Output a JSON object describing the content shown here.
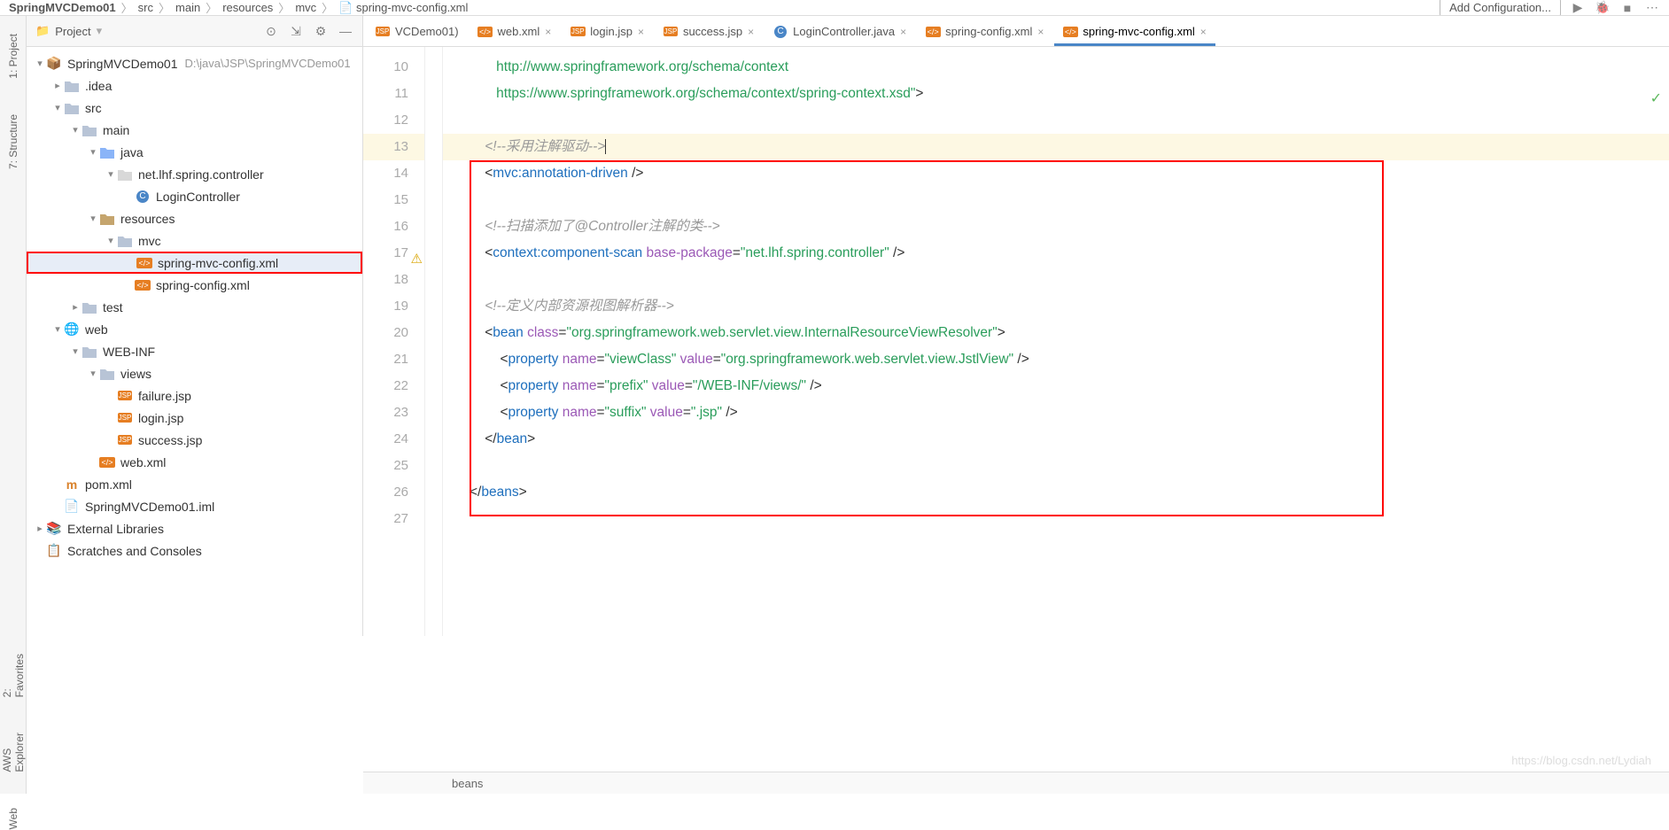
{
  "breadcrumb": [
    "SpringMVCDemo01",
    "src",
    "main",
    "resources",
    "mvc",
    "spring-mvc-config.xml"
  ],
  "addConfig": "Add Configuration...",
  "leftRail": [
    "1: Project",
    "7: Structure",
    "2: Favorites",
    "AWS Explorer",
    "Web"
  ],
  "panel": {
    "title": "Project",
    "root": "SpringMVCDemo01",
    "rootPath": "D:\\java\\JSP\\SpringMVCDemo01"
  },
  "tree": [
    {
      "ind": 0,
      "chev": "down",
      "type": "module",
      "label": "SpringMVCDemo01",
      "extra": "rootPath"
    },
    {
      "ind": 1,
      "chev": "right",
      "type": "folder",
      "label": ".idea"
    },
    {
      "ind": 1,
      "chev": "down",
      "type": "folder",
      "label": "src"
    },
    {
      "ind": 2,
      "chev": "down",
      "type": "folder",
      "label": "main"
    },
    {
      "ind": 3,
      "chev": "down",
      "type": "src",
      "label": "java"
    },
    {
      "ind": 4,
      "chev": "down",
      "type": "pkg",
      "label": "net.lhf.spring.controller"
    },
    {
      "ind": 5,
      "chev": "",
      "type": "class",
      "label": "LoginController"
    },
    {
      "ind": 3,
      "chev": "down",
      "type": "res",
      "label": "resources"
    },
    {
      "ind": 4,
      "chev": "down",
      "type": "folder",
      "label": "mvc"
    },
    {
      "ind": 5,
      "chev": "",
      "type": "xml",
      "label": "spring-mvc-config.xml",
      "active": true,
      "redbox": true
    },
    {
      "ind": 5,
      "chev": "",
      "type": "xml",
      "label": "spring-config.xml"
    },
    {
      "ind": 2,
      "chev": "right",
      "type": "folder",
      "label": "test"
    },
    {
      "ind": 1,
      "chev": "down",
      "type": "web",
      "label": "web"
    },
    {
      "ind": 2,
      "chev": "down",
      "type": "folder",
      "label": "WEB-INF"
    },
    {
      "ind": 3,
      "chev": "down",
      "type": "folder",
      "label": "views"
    },
    {
      "ind": 4,
      "chev": "",
      "type": "jsp",
      "label": "failure.jsp"
    },
    {
      "ind": 4,
      "chev": "",
      "type": "jsp",
      "label": "login.jsp"
    },
    {
      "ind": 4,
      "chev": "",
      "type": "jsp",
      "label": "success.jsp"
    },
    {
      "ind": 3,
      "chev": "",
      "type": "xml",
      "label": "web.xml"
    },
    {
      "ind": 1,
      "chev": "",
      "type": "maven",
      "label": "pom.xml"
    },
    {
      "ind": 1,
      "chev": "",
      "type": "iml",
      "label": "SpringMVCDemo01.iml"
    },
    {
      "ind": 0,
      "chev": "right",
      "type": "lib",
      "label": "External Libraries"
    },
    {
      "ind": 0,
      "chev": "",
      "type": "scratch",
      "label": "Scratches and Consoles"
    }
  ],
  "tabs": [
    {
      "icon": "jsp",
      "label": "VCDemo01)",
      "noclose": true
    },
    {
      "icon": "xml",
      "label": "web.xml"
    },
    {
      "icon": "jsp",
      "label": "login.jsp"
    },
    {
      "icon": "jsp",
      "label": "success.jsp"
    },
    {
      "icon": "java",
      "label": "LoginController.java"
    },
    {
      "icon": "xml",
      "label": "spring-config.xml"
    },
    {
      "icon": "xml",
      "label": "spring-mvc-config.xml",
      "active": true
    }
  ],
  "code": {
    "firstLine": 10,
    "lines": [
      {
        "n": 10,
        "seg": [
          {
            "c": "str",
            "t": "       http://www.springframework.org/schema/context"
          }
        ]
      },
      {
        "n": 11,
        "seg": [
          {
            "c": "str",
            "t": "       https://www.springframework.org/schema/context/spring-context.xsd\""
          },
          {
            "c": "",
            "t": ">"
          }
        ]
      },
      {
        "n": 12,
        "seg": []
      },
      {
        "n": 13,
        "hl": true,
        "seg": [
          {
            "c": "",
            "t": "    "
          },
          {
            "c": "cmt",
            "t": "<!--采用注解驱动-->"
          },
          {
            "c": "cursor",
            "t": ""
          }
        ]
      },
      {
        "n": 14,
        "seg": [
          {
            "c": "",
            "t": "    <"
          },
          {
            "c": "tag",
            "t": "mvc:annotation-driven"
          },
          {
            "c": "",
            "t": " />"
          }
        ]
      },
      {
        "n": 15,
        "seg": []
      },
      {
        "n": 16,
        "seg": [
          {
            "c": "",
            "t": "    "
          },
          {
            "c": "cmt",
            "t": "<!--扫描添加了@Controller注解的类-->"
          }
        ]
      },
      {
        "n": 17,
        "mark": "warn",
        "seg": [
          {
            "c": "",
            "t": "    <"
          },
          {
            "c": "tag",
            "t": "context:component-scan"
          },
          {
            "c": "",
            "t": " "
          },
          {
            "c": "attr",
            "t": "base-package"
          },
          {
            "c": "",
            "t": "="
          },
          {
            "c": "str",
            "t": "\"net.lhf.spring.controller\""
          },
          {
            "c": "",
            "t": " />"
          }
        ]
      },
      {
        "n": 18,
        "seg": []
      },
      {
        "n": 19,
        "seg": [
          {
            "c": "",
            "t": "    "
          },
          {
            "c": "cmt",
            "t": "<!--定义内部资源视图解析器-->"
          }
        ]
      },
      {
        "n": 20,
        "seg": [
          {
            "c": "",
            "t": "    <"
          },
          {
            "c": "tag",
            "t": "bean"
          },
          {
            "c": "",
            "t": " "
          },
          {
            "c": "attr",
            "t": "class"
          },
          {
            "c": "",
            "t": "="
          },
          {
            "c": "str",
            "t": "\"org.springframework.web.servlet.view.InternalResourceViewResolver\""
          },
          {
            "c": "",
            "t": ">"
          }
        ]
      },
      {
        "n": 21,
        "seg": [
          {
            "c": "",
            "t": "        <"
          },
          {
            "c": "tag",
            "t": "property"
          },
          {
            "c": "",
            "t": " "
          },
          {
            "c": "attr",
            "t": "name"
          },
          {
            "c": "",
            "t": "="
          },
          {
            "c": "str",
            "t": "\"viewClass\""
          },
          {
            "c": "",
            "t": " "
          },
          {
            "c": "attr",
            "t": "value"
          },
          {
            "c": "",
            "t": "="
          },
          {
            "c": "str",
            "t": "\"org.springframework.web.servlet.view.JstlView\""
          },
          {
            "c": "",
            "t": " />"
          }
        ]
      },
      {
        "n": 22,
        "seg": [
          {
            "c": "",
            "t": "        <"
          },
          {
            "c": "tag",
            "t": "property"
          },
          {
            "c": "",
            "t": " "
          },
          {
            "c": "attr",
            "t": "name"
          },
          {
            "c": "",
            "t": "="
          },
          {
            "c": "str",
            "t": "\"prefix\""
          },
          {
            "c": "",
            "t": " "
          },
          {
            "c": "attr",
            "t": "value"
          },
          {
            "c": "",
            "t": "="
          },
          {
            "c": "str",
            "t": "\"/WEB-INF/views/\""
          },
          {
            "c": "",
            "t": " />"
          }
        ]
      },
      {
        "n": 23,
        "seg": [
          {
            "c": "",
            "t": "        <"
          },
          {
            "c": "tag",
            "t": "property"
          },
          {
            "c": "",
            "t": " "
          },
          {
            "c": "attr",
            "t": "name"
          },
          {
            "c": "",
            "t": "="
          },
          {
            "c": "str",
            "t": "\"suffix\""
          },
          {
            "c": "",
            "t": " "
          },
          {
            "c": "attr",
            "t": "value"
          },
          {
            "c": "",
            "t": "="
          },
          {
            "c": "str",
            "t": "\".jsp\""
          },
          {
            "c": "",
            "t": " />"
          }
        ]
      },
      {
        "n": 24,
        "seg": [
          {
            "c": "",
            "t": "    </"
          },
          {
            "c": "tag",
            "t": "bean"
          },
          {
            "c": "",
            "t": ">"
          }
        ]
      },
      {
        "n": 25,
        "seg": []
      },
      {
        "n": 26,
        "seg": [
          {
            "c": "",
            "t": "</"
          },
          {
            "c": "tag",
            "t": "beans"
          },
          {
            "c": "",
            "t": ">"
          }
        ]
      },
      {
        "n": 27,
        "seg": []
      }
    ]
  },
  "status": "beans",
  "watermark": "https://blog.csdn.net/Lydiah"
}
